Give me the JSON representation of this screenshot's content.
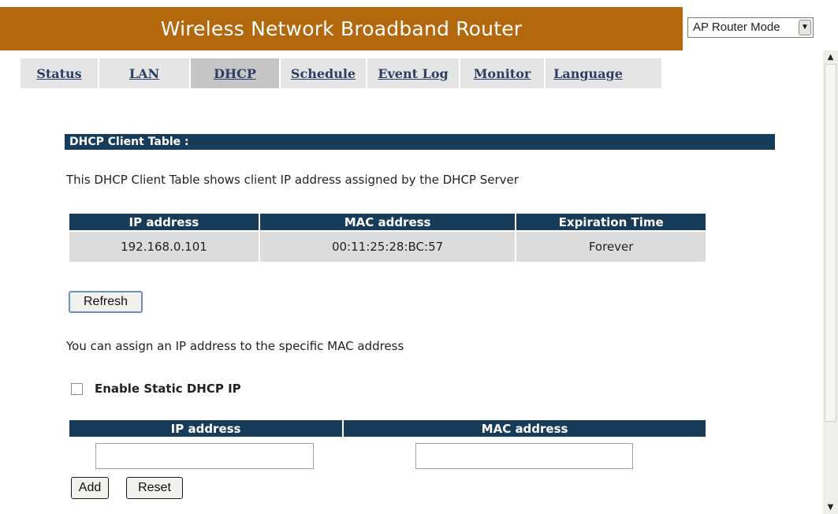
{
  "header": {
    "title": "Wireless Network Broadband Router",
    "mode_select_value": "AP Router Mode"
  },
  "tabs": [
    {
      "label": "Status"
    },
    {
      "label": "LAN"
    },
    {
      "label": "DHCP",
      "active": true
    },
    {
      "label": "Schedule"
    },
    {
      "label": "Event Log"
    },
    {
      "label": "Monitor"
    },
    {
      "label": "Language"
    }
  ],
  "client_table": {
    "section_title": "DHCP Client Table :",
    "description": "This DHCP Client Table shows client IP address assigned by the DHCP Server",
    "columns": [
      "IP address",
      "MAC address",
      "Expiration Time"
    ],
    "rows": [
      {
        "ip": "192.168.0.101",
        "mac": "00:11:25:28:BC:57",
        "expiration": "Forever"
      }
    ],
    "refresh_label": "Refresh"
  },
  "static": {
    "description": "You can assign an IP address to the specific MAC address",
    "enable_label": "Enable Static DHCP IP",
    "enable_checked": false,
    "columns": [
      "IP address",
      "MAC address"
    ],
    "ip_value": "",
    "mac_value": "",
    "add_label": "Add",
    "reset_label": "Reset"
  },
  "icons": {
    "dropdown": "chevron-down-icon",
    "scroll_up": "scroll-up-arrow-icon",
    "scroll_down": "scroll-down-arrow-icon"
  },
  "colors": {
    "header_bar": "#b3680d",
    "section_bar": "#173c5a",
    "tab_text": "#2d3d64",
    "table_row": "#dcdcdc"
  }
}
